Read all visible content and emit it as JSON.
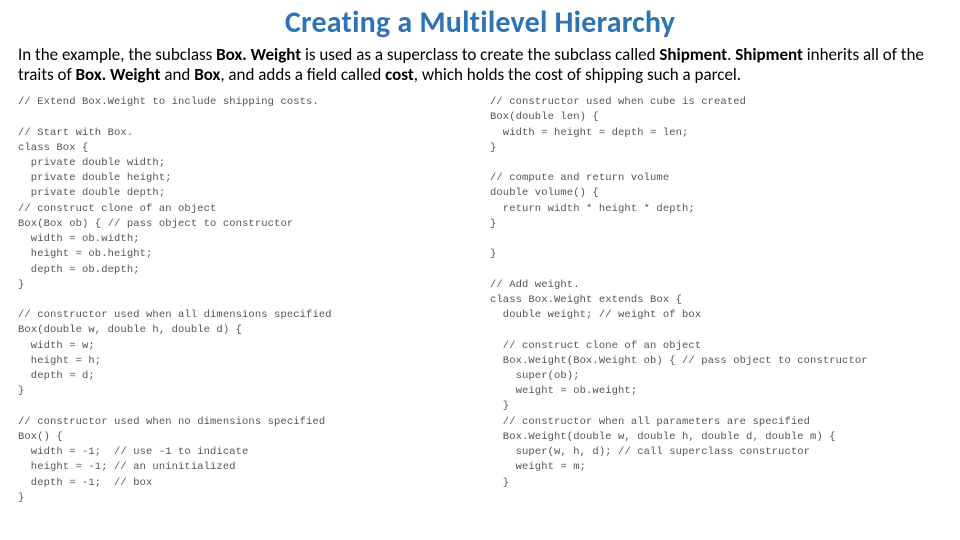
{
  "title": "Creating a Multilevel Hierarchy",
  "intro": {
    "t1": "In the example, the subclass ",
    "b1": "Box. Weight",
    "t2": " is used as a superclass to create the subclass called ",
    "b2": "Shipment",
    "t3": ". ",
    "b3": "Shipment",
    "t4": " inherits all of the traits of ",
    "b4": "Box. Weight ",
    "t5": "and ",
    "b5": "Box",
    "t6": ", and adds a field called ",
    "b6": "cost",
    "t7": ", which holds the cost of shipping such a parcel."
  },
  "code_left": "// Extend Box.Weight to include shipping costs.\n\n// Start with Box.\nclass Box {\n  private double width;\n  private double height;\n  private double depth;\n// construct clone of an object\nBox(Box ob) { // pass object to constructor\n  width = ob.width;\n  height = ob.height;\n  depth = ob.depth;\n}\n\n// constructor used when all dimensions specified\nBox(double w, double h, double d) {\n  width = w;\n  height = h;\n  depth = d;\n}\n\n// constructor used when no dimensions specified\nBox() {\n  width = -1;  // use -1 to indicate\n  height = -1; // an uninitialized\n  depth = -1;  // box\n}",
  "code_right": "// constructor used when cube is created\nBox(double len) {\n  width = height = depth = len;\n}\n\n// compute and return volume\ndouble volume() {\n  return width * height * depth;\n}\n\n}\n\n// Add weight.\nclass Box.Weight extends Box {\n  double weight; // weight of box\n\n  // construct clone of an object\n  Box.Weight(Box.Weight ob) { // pass object to constructor\n    super(ob);\n    weight = ob.weight;\n  }\n  // constructor when all parameters are specified\n  Box.Weight(double w, double h, double d, double m) {\n    super(w, h, d); // call superclass constructor\n    weight = m;\n  }"
}
